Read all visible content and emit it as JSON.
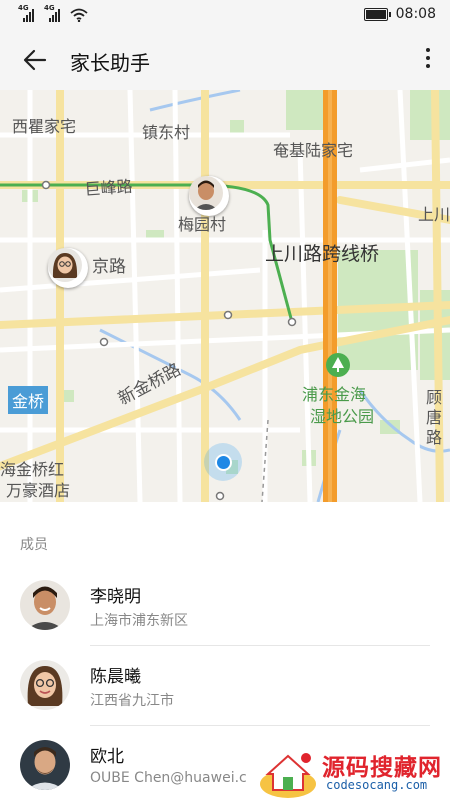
{
  "status_bar": {
    "signal_1": "4G",
    "signal_2": "4G",
    "time": "08:08"
  },
  "app_bar": {
    "back_icon": "arrow-left-icon",
    "title": "家长助手",
    "more_icon": "more-vertical-icon"
  },
  "map": {
    "labels": {
      "xiqu": "西瞿家宅",
      "zhendong": "镇东村",
      "yanji": "奄基陆家宅",
      "jufeng": "巨峰路",
      "meiyuan": "梅园村",
      "shangchuan_r": "上川",
      "jingroad": "京路",
      "bridge": "上川路跨线桥",
      "jinqiao_road": "新金桥路",
      "jinqiao_badge": "金桥",
      "park": "浦东金海湿地公园",
      "gutang": "顾唐路",
      "hotel_1": "海金桥红",
      "hotel_2": "万豪酒店"
    }
  },
  "members_section": {
    "label": "成员",
    "members": [
      {
        "name": "李晓明",
        "location": "上海市浦东新区"
      },
      {
        "name": "陈晨曦",
        "location": "江西省九江市"
      },
      {
        "name": "欧北",
        "location": "OUBE Chen@huawei.c"
      }
    ]
  },
  "watermark": {
    "title": "源码搜藏网",
    "url": "codesocang.com"
  },
  "colors": {
    "route_green": "#4caf50",
    "highway_orange": "#f39c2b",
    "location_blue": "#1e88e5",
    "badge_blue": "#4a9cd6"
  }
}
